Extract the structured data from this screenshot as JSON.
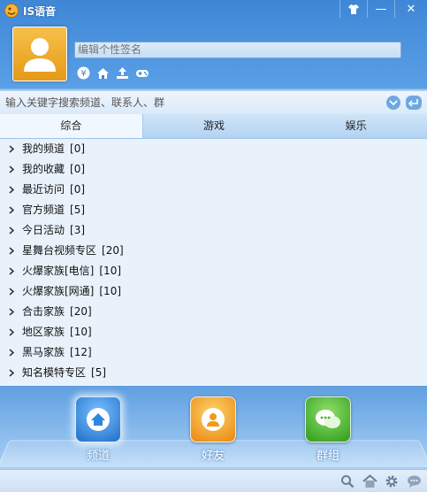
{
  "app": {
    "title": "IS语音"
  },
  "window": {
    "skin_icon": "tshirt-icon",
    "minimize": "—",
    "close": "✕"
  },
  "profile": {
    "signature_placeholder": "编辑个性签名",
    "quick_icons": [
      "yen-icon",
      "home-icon",
      "upload-icon",
      "gamepad-icon"
    ]
  },
  "search": {
    "placeholder": "输入关键字搜索频道、联系人、群"
  },
  "tabs": [
    {
      "label": "综合",
      "active": true
    },
    {
      "label": "游戏",
      "active": false
    },
    {
      "label": "娱乐",
      "active": false
    }
  ],
  "list": [
    {
      "label": "我的频道",
      "count": "[0]"
    },
    {
      "label": "我的收藏",
      "count": "[0]"
    },
    {
      "label": "最近访问",
      "count": "[0]"
    },
    {
      "label": "官方频道",
      "count": "[5]"
    },
    {
      "label": "今日活动",
      "count": "[3]"
    },
    {
      "label": "星舞台视频专区",
      "count": "[20]"
    },
    {
      "label": "火爆家族[电信]",
      "count": "[10]"
    },
    {
      "label": "火爆家族[网通]",
      "count": "[10]"
    },
    {
      "label": "合击家族",
      "count": "[20]"
    },
    {
      "label": "地区家族",
      "count": "[10]"
    },
    {
      "label": "黑马家族",
      "count": "[12]"
    },
    {
      "label": "知名模特专区",
      "count": "[5]"
    }
  ],
  "dock": [
    {
      "label": "频道",
      "icon": "home-icon",
      "color": "#2f86e0",
      "selected": true
    },
    {
      "label": "好友",
      "icon": "friend-icon",
      "color": "#f39a16",
      "selected": false
    },
    {
      "label": "群组",
      "icon": "chat-group-icon",
      "color": "#43b52a",
      "selected": false
    }
  ],
  "footer": {
    "icons": [
      "search-icon",
      "home-icon",
      "gear-icon",
      "message-icon"
    ]
  },
  "colors": {
    "accent": "#3f86d6",
    "list_bg": "#e9f2fb",
    "avatar": "#f2ad2e"
  }
}
